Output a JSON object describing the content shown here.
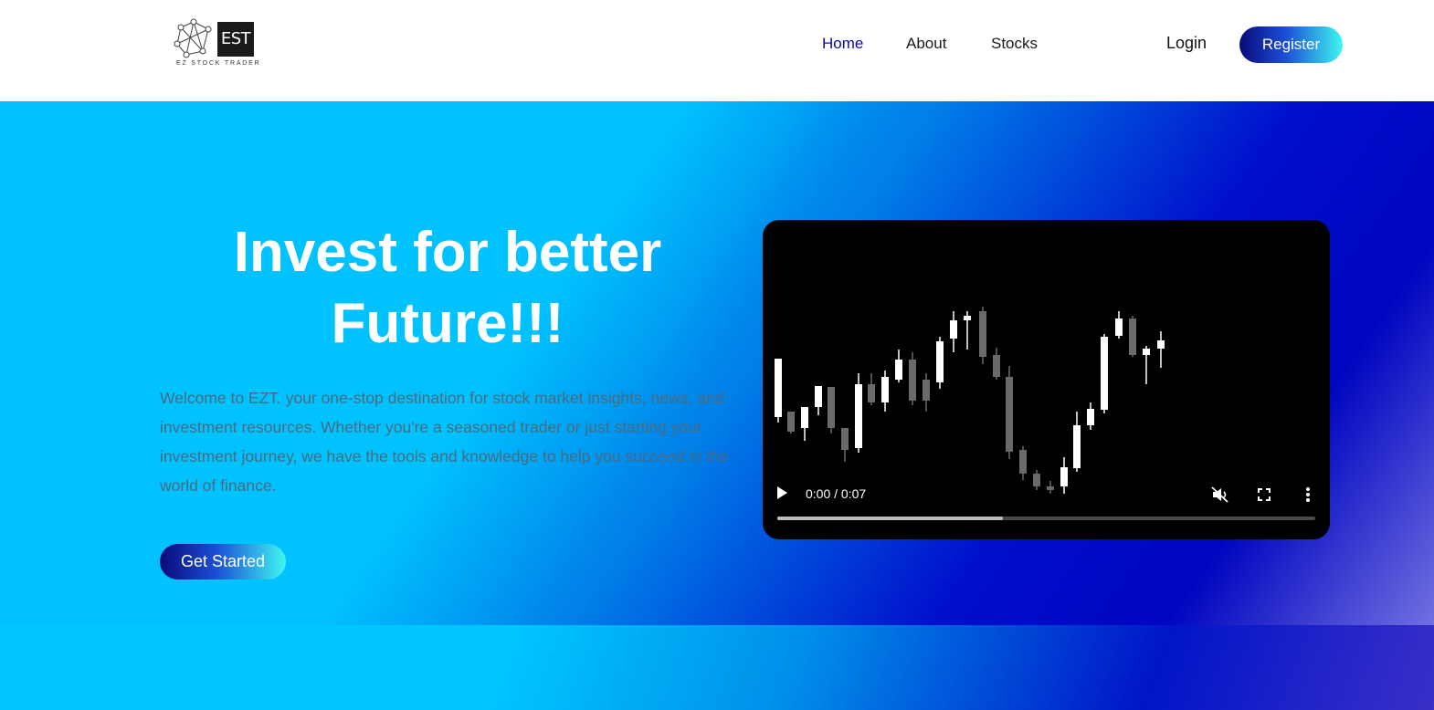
{
  "header": {
    "logo": {
      "mark_text": "EST",
      "tagline": "EZ STOCK TRADER"
    },
    "nav": [
      {
        "label": "Home",
        "active": true
      },
      {
        "label": "About",
        "active": false
      },
      {
        "label": "Stocks",
        "active": false
      }
    ],
    "login_label": "Login",
    "register_label": "Register"
  },
  "hero": {
    "title_line1": "Invest for better",
    "title_line2": "Future!!!",
    "description": "Welcome to EZT. your one-stop destination for stock market insights, news, and investment resources. Whether you're a seasoned trader or just starting your investment journey, we have the tools and knowledge to help you succeed in the world of finance.",
    "cta_label": "Get Started"
  },
  "video": {
    "time_display": "0:00 / 0:07",
    "progress": 0.42,
    "muted": true,
    "icons": [
      "play-icon",
      "mute-icon",
      "fullscreen-icon",
      "more-options-icon"
    ]
  },
  "colors": {
    "nav_active": "#0a0ab0",
    "accent_gradient_start": "#0a0a7a",
    "accent_gradient_end": "#3ff7f0",
    "hero_cyan": "#00c2ff",
    "hero_blue": "#0008c8"
  }
}
